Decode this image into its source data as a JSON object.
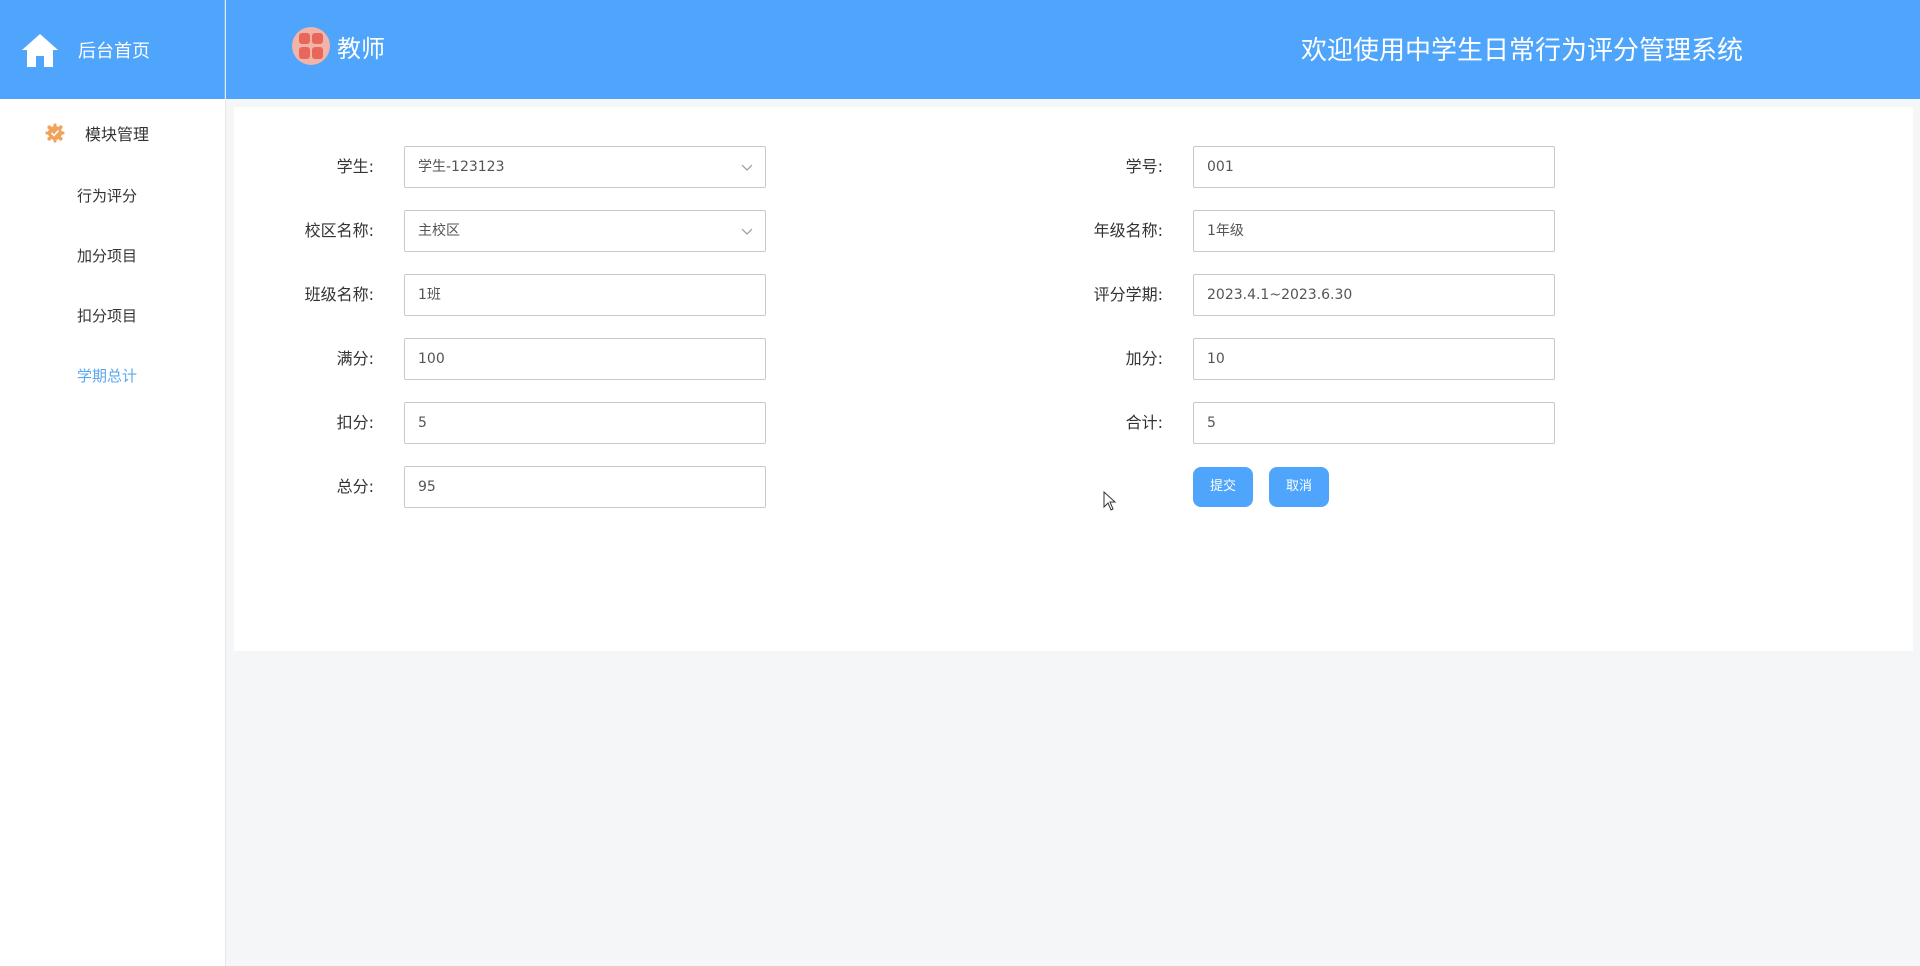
{
  "sidebar": {
    "home_label": "后台首页",
    "section_label": "模块管理",
    "items": [
      {
        "label": "行为评分"
      },
      {
        "label": "加分项目"
      },
      {
        "label": "扣分项目"
      },
      {
        "label": "学期总计"
      }
    ]
  },
  "header": {
    "role_label": "教师",
    "system_title": "欢迎使用中学生日常行为评分管理系统"
  },
  "form": {
    "student": {
      "label": "学生:",
      "value": "学生-123123"
    },
    "student_no": {
      "label": "学号:",
      "value": "001"
    },
    "campus": {
      "label": "校区名称:",
      "value": "主校区"
    },
    "grade": {
      "label": "年级名称:",
      "value": "1年级"
    },
    "class_name": {
      "label": "班级名称:",
      "value": "1班"
    },
    "term": {
      "label": "评分学期:",
      "value": "2023.4.1~2023.6.30"
    },
    "full_score": {
      "label": "满分:",
      "value": "100"
    },
    "bonus": {
      "label": "加分:",
      "value": "10"
    },
    "deduction": {
      "label": "扣分:",
      "value": "5"
    },
    "subtotal": {
      "label": "合计:",
      "value": "5"
    },
    "total": {
      "label": "总分:",
      "value": "95"
    },
    "submit_label": "提交",
    "cancel_label": "取消"
  },
  "colors": {
    "primary": "#4fa5fb",
    "active_menu": "#5aa7ee"
  },
  "icons": {
    "home": "home-icon",
    "section": "gear-icon",
    "avatar": "avatar-icon",
    "select": "chevron-down-icon",
    "cursor": "cursor-icon"
  }
}
